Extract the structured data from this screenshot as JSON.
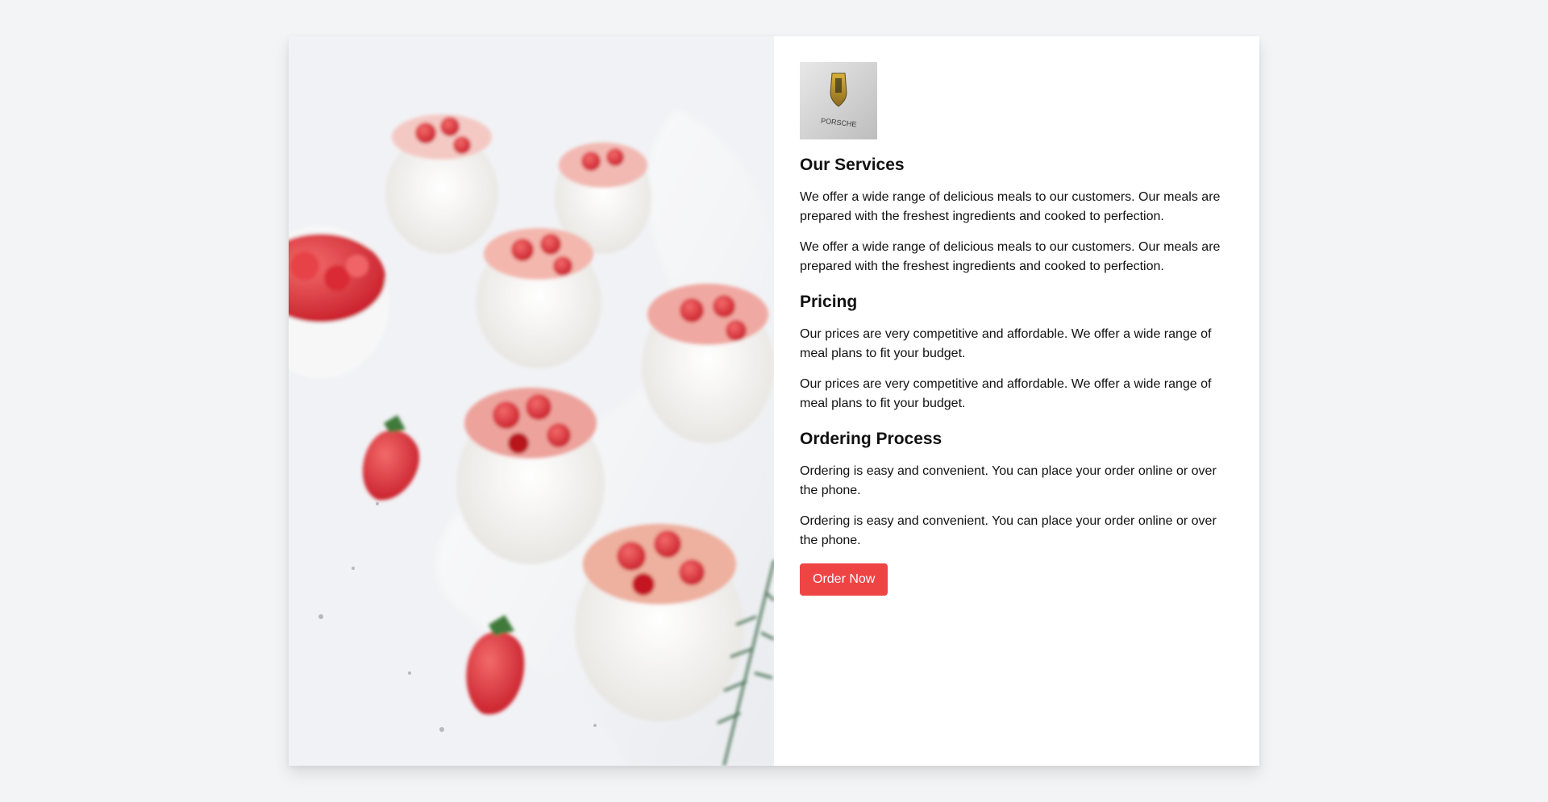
{
  "logo": {
    "alt": "PORSCHE",
    "wordmark": "PORSCHE"
  },
  "sections": [
    {
      "heading": "Our Services",
      "paragraphs": [
        "We offer a wide range of delicious meals to our customers. Our meals are prepared with the freshest ingredients and cooked to perfection.",
        "We offer a wide range of delicious meals to our customers. Our meals are prepared with the freshest ingredients and cooked to perfection."
      ]
    },
    {
      "heading": "Pricing",
      "paragraphs": [
        "Our prices are very competitive and affordable. We offer a wide range of meal plans to fit your budget.",
        "Our prices are very competitive and affordable. We offer a wide range of meal plans to fit your budget."
      ]
    },
    {
      "heading": "Ordering Process",
      "paragraphs": [
        "Ordering is easy and convenient. You can place your order online or over the phone.",
        "Ordering is easy and convenient. You can place your order online or over the phone."
      ]
    }
  ],
  "cta": {
    "label": "Order Now",
    "color": "#ef4444"
  },
  "hero": {
    "icon": "strawberry-dessert-photo"
  }
}
